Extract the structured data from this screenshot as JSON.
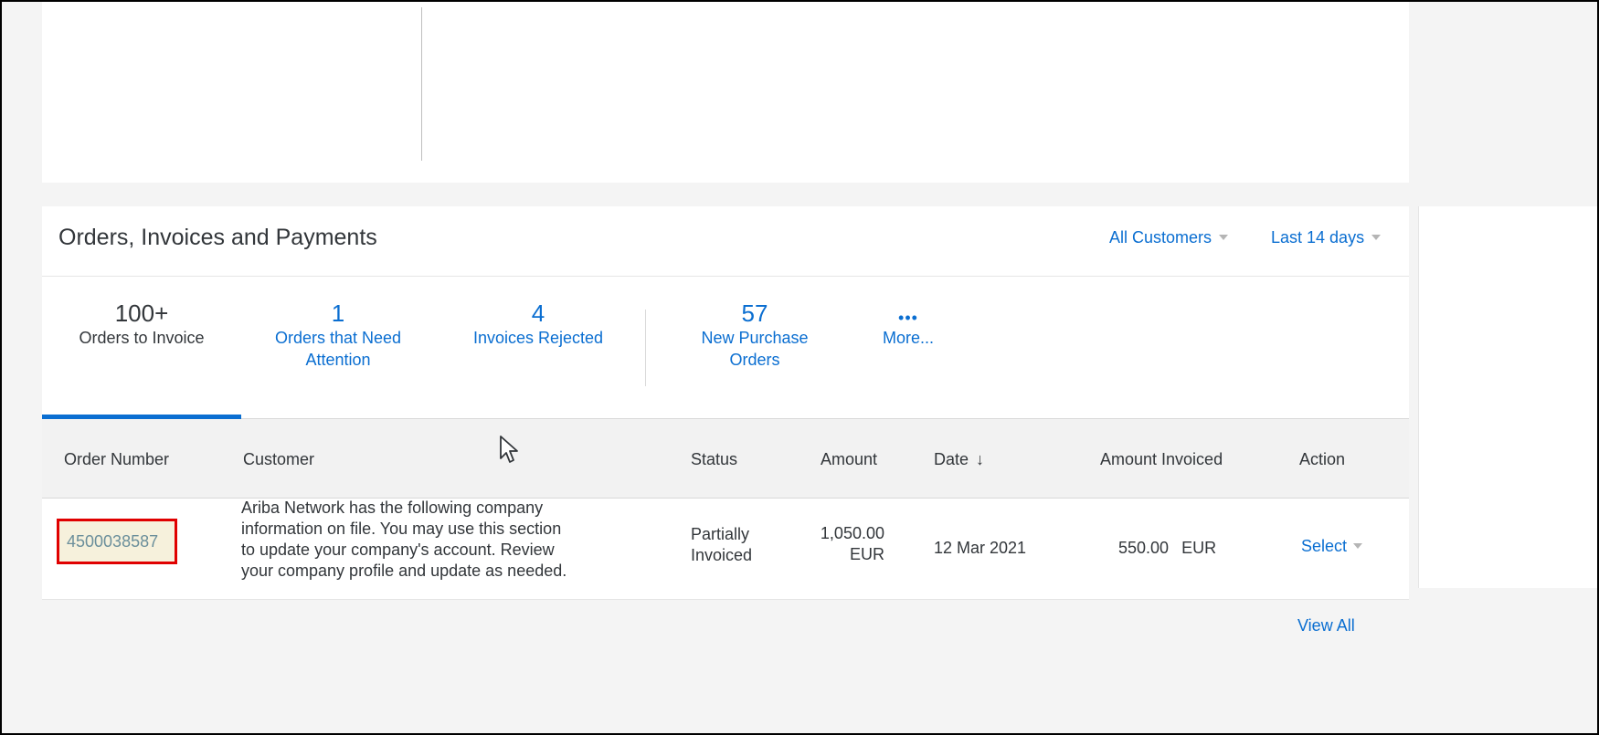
{
  "card": {
    "title": "Orders, Invoices and Payments",
    "filters": {
      "customers": "All Customers",
      "period": "Last 14 days"
    }
  },
  "tiles": [
    {
      "count": "100+",
      "label_lines": [
        "Orders to Invoice"
      ],
      "active": true
    },
    {
      "count": "1",
      "label_lines": [
        "Orders that Need",
        "Attention"
      ],
      "active": false
    },
    {
      "count": "4",
      "label_lines": [
        "Invoices Rejected"
      ],
      "active": false
    },
    {
      "count": "57",
      "label_lines": [
        "New Purchase",
        "Orders"
      ],
      "active": false
    },
    {
      "count": "•••",
      "label_lines": [
        "More..."
      ],
      "active": false
    }
  ],
  "table": {
    "headers": {
      "order_number": "Order Number",
      "customer": "Customer",
      "status": "Status",
      "amount": "Amount",
      "date": "Date",
      "amount_invoiced": "Amount Invoiced",
      "action": "Action"
    },
    "sort_indicator": "sort-down-icon",
    "rows": [
      {
        "order_number": "4500038587",
        "customer_lines": [
          "Ariba Network has the following company",
          "information on file. You may use this section",
          "to update your company's account. Review",
          "your company profile and update as needed."
        ],
        "status_lines": [
          "Partially",
          "Invoiced"
        ],
        "amount_lines": [
          "1,050.00",
          "EUR"
        ],
        "date": "12 Mar 2021",
        "amount_invoiced": "550.00",
        "amount_invoiced_currency": "EUR",
        "action": "Select"
      }
    ]
  },
  "footer": {
    "view_all": "View All"
  },
  "colors": {
    "link": "#0a6ed1",
    "highlight_border": "#e00000",
    "highlight_fill": "#f6f1dc"
  }
}
